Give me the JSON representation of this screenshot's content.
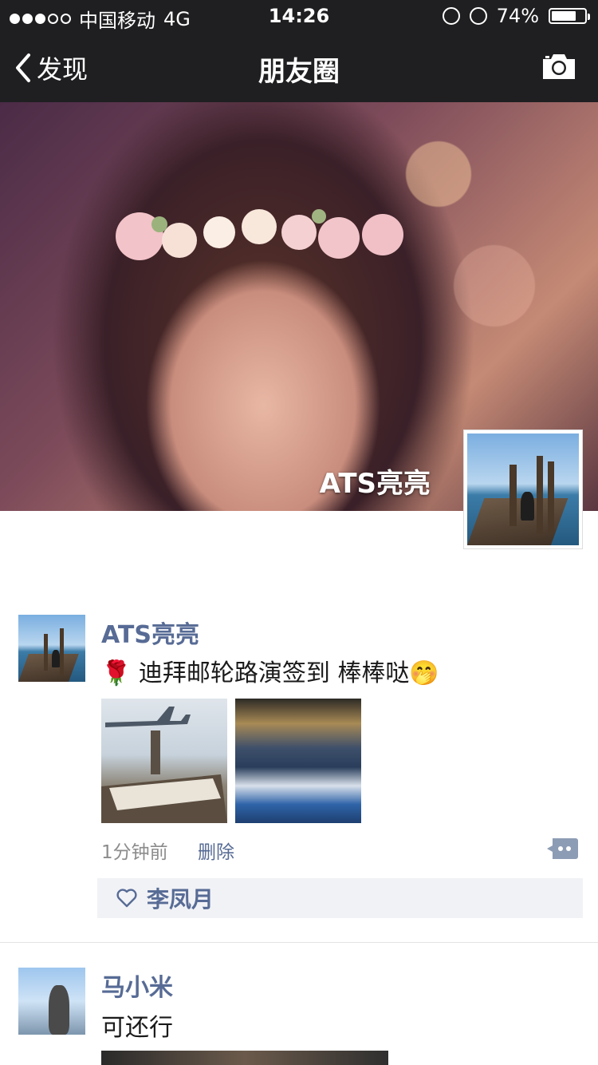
{
  "status_bar": {
    "carrier": "中国移动",
    "network": "4G",
    "time": "14:26",
    "battery_text": "74%",
    "battery_level": 0.74
  },
  "nav": {
    "back_label": "发现",
    "title": "朋友圈",
    "camera_icon": "camera-icon"
  },
  "cover": {
    "user_name": "ATS亮亮"
  },
  "posts": [
    {
      "name": "ATS亮亮",
      "text": "🌹 迪拜邮轮路演签到 棒棒哒🤭",
      "time": "1分钟前",
      "delete_label": "删除",
      "likes": [
        "李凤月"
      ]
    },
    {
      "name": "马小米",
      "text": "可还行"
    }
  ],
  "colors": {
    "nav_bg": "#1f1f21",
    "link": "#576b95",
    "likes_bg": "#f1f2f6"
  }
}
